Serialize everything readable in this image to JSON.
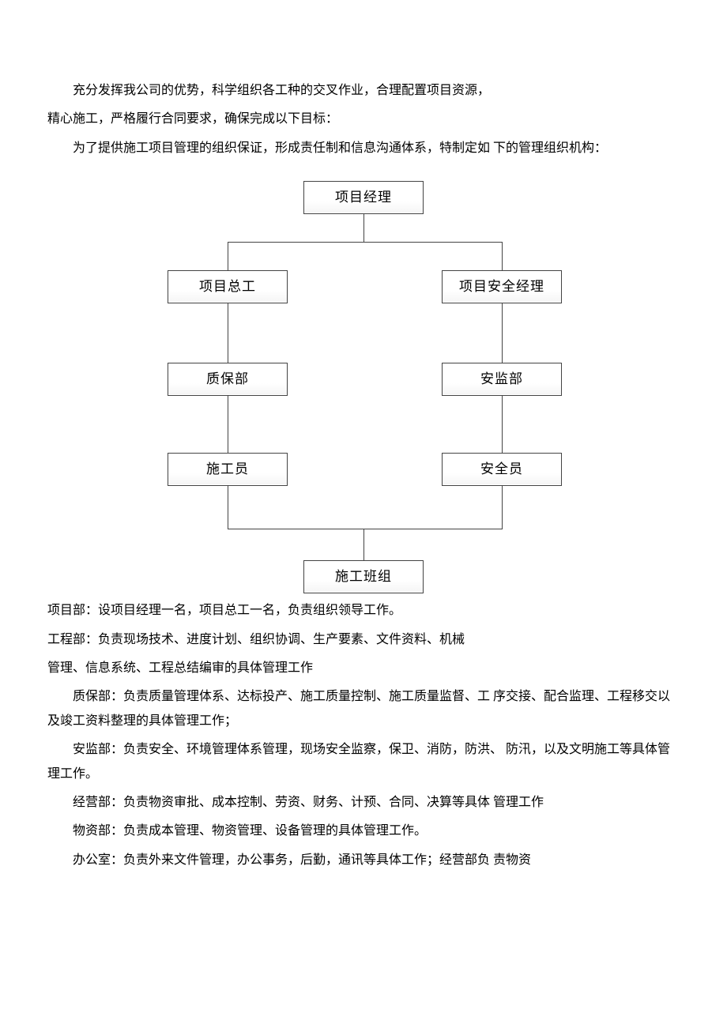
{
  "paragraphs": {
    "p1": "充分发挥我公司的优势，科学组织各工种的交叉作业，合理配置项目资源，",
    "p2": "精心施工，严格履行合同要求，确保完成以下目标：",
    "p3": "为了提供施工项目管理的组织保证，形成责任制和信息沟通体系，特制定如 下的管理组织机构：",
    "p4": "项目部：设项目经理一名，项目总工一名，负责组织领导工作。",
    "p5": "工程部：负责现场技术、进度计划、组织协调、生产要素、文件资料、机械",
    "p6": "管理、信息系统、工程总结编审的具体管理工作",
    "p7": "质保部：负责质量管理体系、达标投产、施工质量控制、施工质量监督、工 序交接、配合监理、工程移交以及竣工资料整理的具体管理工作；",
    "p8": "安监部：负责安全、环境管理体系管理，现场安全监察，保卫、消防，防洪、  防汛，以及文明施工等具体管理工作。",
    "p9": "经营部：负责物资审批、成本控制、劳资、财务、计预、合同、决算等具体 管理工作",
    "p10": "物资部：负责成本管理、物资管理、设备管理的具体管理工作。",
    "p11": "办公室：负责外来文件管理，办公事务，后勤，通讯等具体工作；经营部负 责物资"
  },
  "chart_data": {
    "type": "org-chart",
    "title": "",
    "nodes": [
      {
        "id": "pm",
        "label": "项目经理",
        "level": 0
      },
      {
        "id": "chief",
        "label": "项目总工",
        "level": 1,
        "parent": "pm"
      },
      {
        "id": "safemgr",
        "label": "项目安全经理",
        "level": 1,
        "parent": "pm"
      },
      {
        "id": "qa",
        "label": "质保部",
        "level": 2,
        "parent": "chief"
      },
      {
        "id": "safety",
        "label": "安监部",
        "level": 2,
        "parent": "safemgr"
      },
      {
        "id": "builder",
        "label": "施工员",
        "level": 3,
        "parent": "qa"
      },
      {
        "id": "safeop",
        "label": "安全员",
        "level": 3,
        "parent": "safety"
      },
      {
        "id": "team",
        "label": "施工班组",
        "level": 4,
        "parents": [
          "builder",
          "safeop"
        ]
      }
    ]
  }
}
